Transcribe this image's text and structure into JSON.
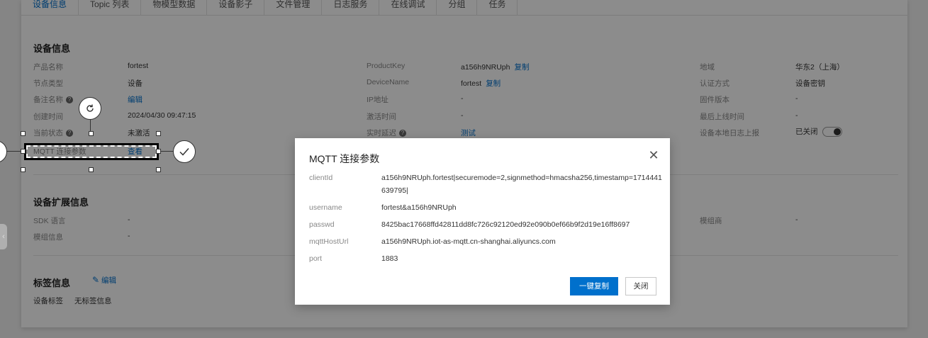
{
  "tabs": [
    "设备信息",
    "Topic 列表",
    "物模型数据",
    "设备影子",
    "文件管理",
    "日志服务",
    "在线调试",
    "分组",
    "任务"
  ],
  "device_info": {
    "title": "设备信息",
    "product_name_label": "产品名称",
    "product_name": "fortest",
    "node_type_label": "节点类型",
    "node_type": "设备",
    "remark_label": "备注名称",
    "remark_edit": "编辑",
    "created_label": "创建时间",
    "created": "2024/04/30 09:47:15",
    "status_label": "当前状态",
    "status": "未激活",
    "mqtt_label": "MQTT 连接参数",
    "mqtt_view": "查看",
    "productkey_label": "ProductKey",
    "productkey": "a156h9NRUph",
    "copy": "复制",
    "devicename_label": "DeviceName",
    "devicename": "fortest",
    "ip_label": "IP地址",
    "ip": "-",
    "activated_label": "激活时间",
    "activated": "-",
    "latency_label": "实时延迟",
    "latency_test": "测试",
    "region_label": "地域",
    "region": "华东2（上海）",
    "auth_label": "认证方式",
    "auth": "设备密钥",
    "firmware_label": "固件版本",
    "firmware": "-",
    "last_online_label": "最后上线时间",
    "last_online": "-",
    "local_log_label": "设备本地日志上报",
    "local_log": "已关闭"
  },
  "ext_info": {
    "title": "设备扩展信息",
    "sdk_label": "SDK 语言",
    "sdk": "-",
    "module_label": "模组信息",
    "module": "-",
    "vendor_label": "模组商",
    "vendor": "-"
  },
  "tag_info": {
    "title": "标签信息",
    "edit": "编辑",
    "device_tag_label": "设备标签",
    "device_tag": "无标签信息"
  },
  "modal": {
    "title": "MQTT 连接参数",
    "rows": [
      {
        "label": "clientId",
        "value": "a156h9NRUph.fortest|securemode=2,signmethod=hmacsha256,timestamp=1714441639795|"
      },
      {
        "label": "username",
        "value": "fortest&a156h9NRUph"
      },
      {
        "label": "passwd",
        "value": "8425bac17668ffd42811dd8fc726c92120ed92e090b0ef66b9f2d19e16ff8697"
      },
      {
        "label": "mqttHostUrl",
        "value": "a156h9NRUph.iot-as-mqtt.cn-shanghai.aliyuncs.com"
      },
      {
        "label": "port",
        "value": "1883"
      }
    ],
    "copy_all": "一键复制",
    "close": "关闭"
  },
  "colors": {
    "accent": "#0070cc",
    "overlay": "rgba(0,0,0,0.45)"
  }
}
